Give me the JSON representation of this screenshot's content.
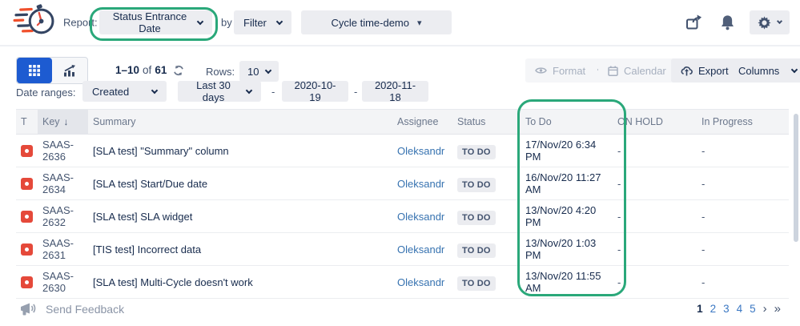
{
  "header": {
    "report_label": "Report:",
    "report_dropdown": "Status Entrance Date",
    "by_label": "by",
    "filter_dropdown": "Filter",
    "scope_dropdown": "Cycle time-demo"
  },
  "toolbar": {
    "range": "1–10",
    "of": "of",
    "total": "61",
    "rows_label": "Rows:",
    "rows_value": "10",
    "format": "Format",
    "calendar": "Calendar",
    "export": "Export",
    "columns": "Columns"
  },
  "date_ranges": {
    "label": "Date ranges:",
    "field": "Created",
    "preset": "Last 30 days",
    "from": "2020-10-19",
    "separator": "-",
    "to": "2020-11-18"
  },
  "table": {
    "columns": [
      "T",
      "Key",
      "Summary",
      "Assignee",
      "Status",
      "To Do",
      "ON HOLD",
      "In Progress"
    ],
    "rows": [
      {
        "key": "SAAS-2636",
        "summary": "[SLA test] \"Summary\" column",
        "assignee": "Oleksandr",
        "status": "TO DO",
        "todo": "17/Nov/20 6:34 PM",
        "on_hold": "-",
        "in_progress": "-"
      },
      {
        "key": "SAAS-2634",
        "summary": "[SLA test] Start/Due date",
        "assignee": "Oleksandr",
        "status": "TO DO",
        "todo": "16/Nov/20 11:27 AM",
        "on_hold": "-",
        "in_progress": "-"
      },
      {
        "key": "SAAS-2632",
        "summary": "[SLA test] SLA widget",
        "assignee": "Oleksandr",
        "status": "TO DO",
        "todo": "13/Nov/20 4:20 PM",
        "on_hold": "-",
        "in_progress": "-"
      },
      {
        "key": "SAAS-2631",
        "summary": "[TIS test] Incorrect data",
        "assignee": "Oleksandr",
        "status": "TO DO",
        "todo": "13/Nov/20 1:03 PM",
        "on_hold": "-",
        "in_progress": "-"
      },
      {
        "key": "SAAS-2630",
        "summary": "[SLA test] Multi-Cycle doesn't work",
        "assignee": "Oleksandr",
        "status": "TO DO",
        "todo": "13/Nov/20 11:55 AM",
        "on_hold": "-",
        "in_progress": "-"
      }
    ]
  },
  "footer": {
    "feedback": "Send Feedback",
    "pagination": {
      "current": "1",
      "pages": [
        "2",
        "3",
        "4",
        "5"
      ],
      "next": "›",
      "last": "»"
    }
  },
  "icons": {
    "sort_desc": "↓",
    "scope_caret": "▾"
  },
  "colors": {
    "accent_blue": "#1d5bd1",
    "annotation_green": "#2aa87a",
    "bug_red": "#e5493a",
    "link_blue": "#3672b0",
    "badge_bg": "#ebecf0",
    "header_row_bg": "#f3f4f6"
  }
}
